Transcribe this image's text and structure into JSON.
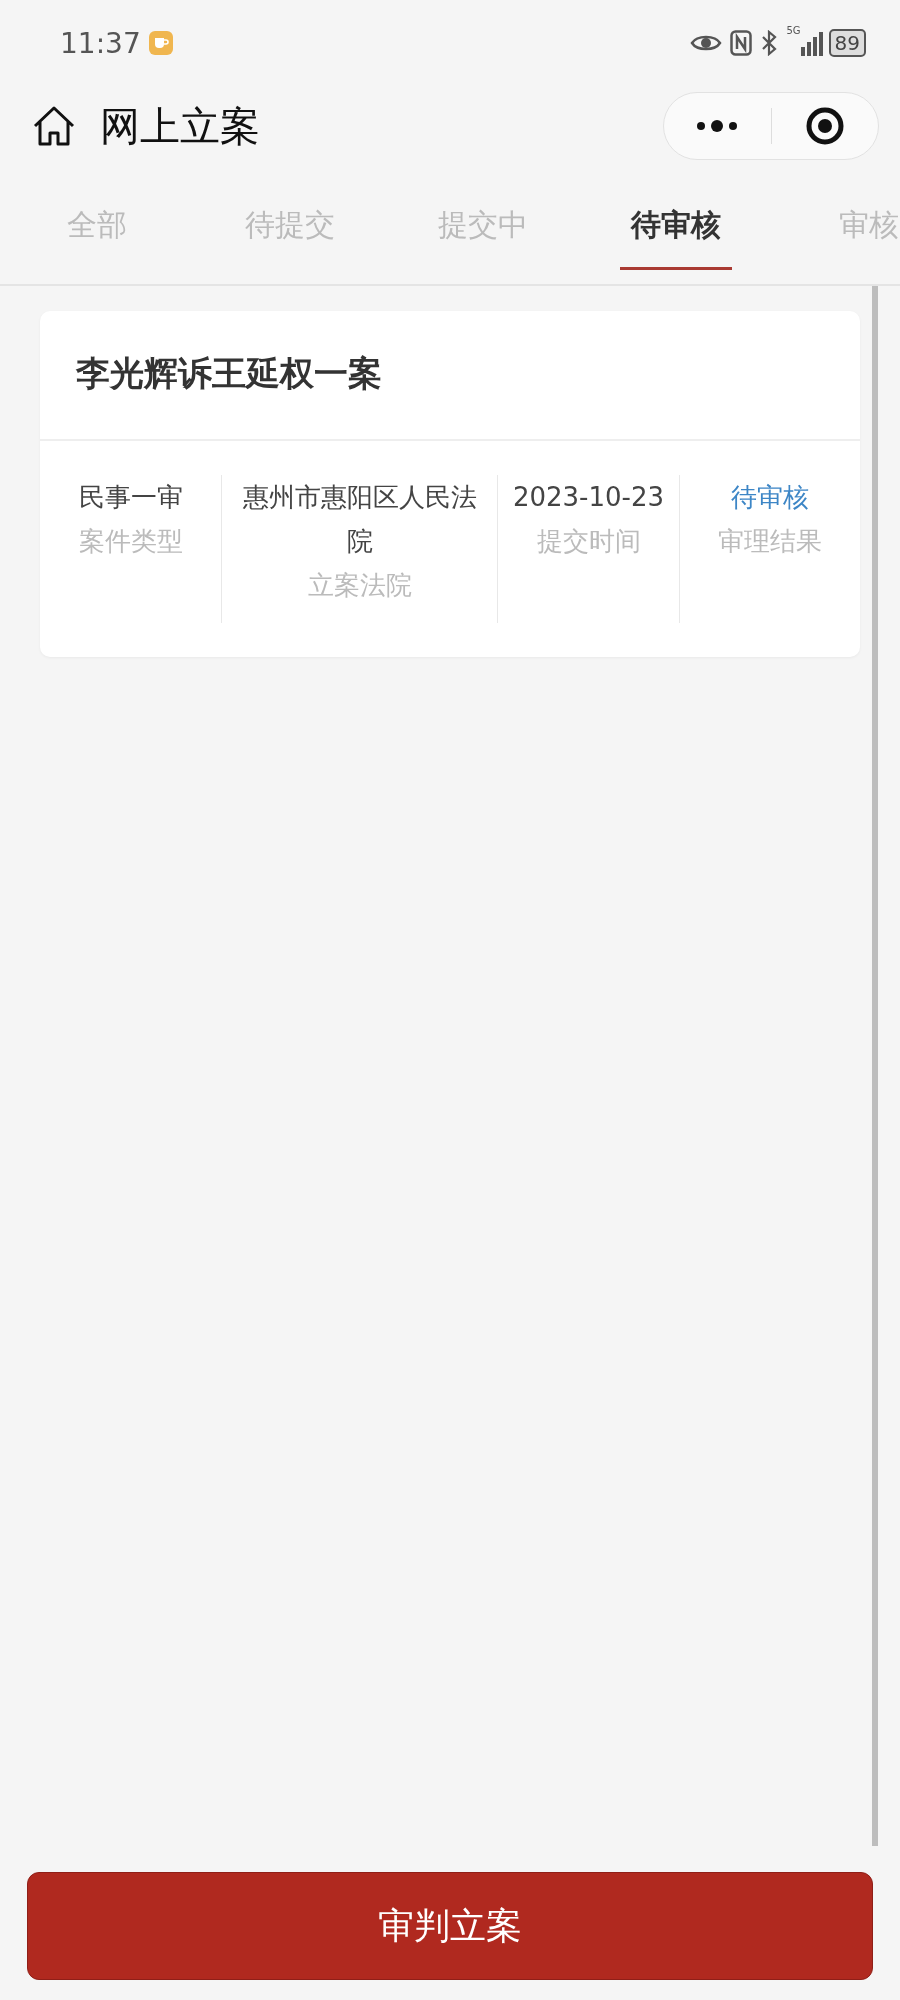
{
  "status_bar": {
    "time": "11:37",
    "network": "5G",
    "battery": "89"
  },
  "header": {
    "title": "网上立案"
  },
  "tabs": [
    {
      "label": "全部",
      "selected": false
    },
    {
      "label": "待提交",
      "selected": false
    },
    {
      "label": "提交中",
      "selected": false
    },
    {
      "label": "待审核",
      "selected": true
    },
    {
      "label": "审核",
      "selected": false
    }
  ],
  "cases": [
    {
      "title": "李光辉诉王延权一案",
      "fields": [
        {
          "kind": "text",
          "value": "民事一审",
          "label": "案件类型"
        },
        {
          "kind": "text",
          "value": "惠州市惠阳区人民法院",
          "label": "立案法院"
        },
        {
          "kind": "text",
          "value": "2023-10-23",
          "label": "提交时间"
        },
        {
          "kind": "status",
          "value": "待审核",
          "label": "审理结果"
        }
      ]
    }
  ],
  "action_button": {
    "label": "审判立案"
  }
}
